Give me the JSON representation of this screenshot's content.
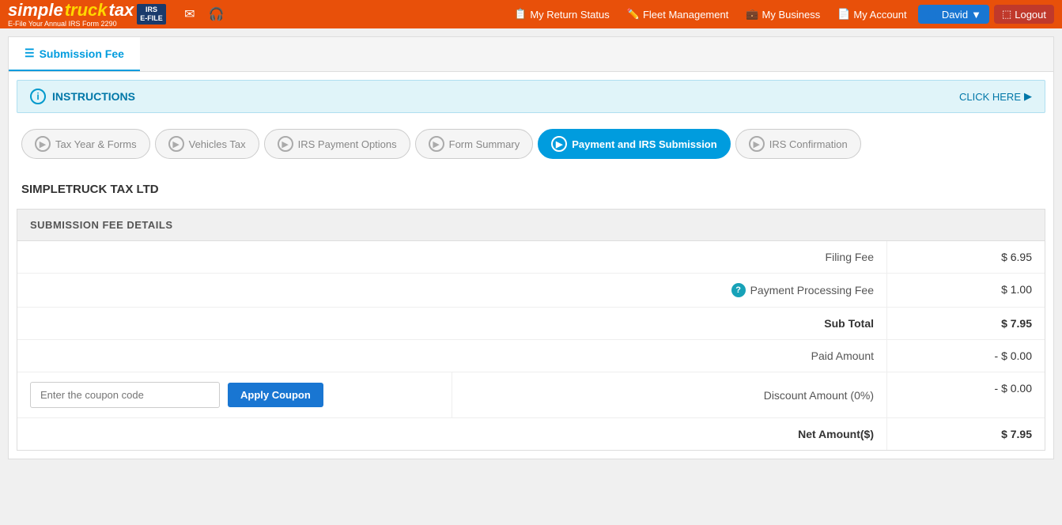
{
  "nav": {
    "logo": {
      "simple": "simple",
      "truck": "truck",
      "tax": " tax",
      "tagline": "E-File Your Annual IRS Form 2290"
    },
    "irs_badge": "IRS\nE-FILE",
    "links": [
      {
        "label": "My Return Status",
        "icon": "📋"
      },
      {
        "label": "Fleet Management",
        "icon": "✏️"
      },
      {
        "label": "My Business",
        "icon": "💼"
      },
      {
        "label": "My Account",
        "icon": "📄"
      }
    ],
    "user_btn": "David",
    "logout_btn": "Logout"
  },
  "tabs": [
    {
      "label": "Submission Fee",
      "active": true
    }
  ],
  "instructions": {
    "label": "INSTRUCTIONS",
    "click_here": "CLICK HERE"
  },
  "steps": [
    {
      "label": "Tax Year & Forms",
      "active": false
    },
    {
      "label": "Vehicles Tax",
      "active": false
    },
    {
      "label": "IRS Payment Options",
      "active": false
    },
    {
      "label": "Form Summary",
      "active": false
    },
    {
      "label": "Payment and IRS Submission",
      "active": true
    },
    {
      "label": "IRS Confirmation",
      "active": false
    }
  ],
  "company_name": "SIMPLETRUCK TAX LTD",
  "fee_section": {
    "header": "SUBMISSION FEE DETAILS",
    "rows": [
      {
        "label": "Filing Fee",
        "value": "$ 6.95",
        "has_help": false,
        "bold": false
      },
      {
        "label": "Payment Processing Fee",
        "value": "$ 1.00",
        "has_help": true,
        "bold": false
      },
      {
        "label": "Sub Total",
        "value": "$ 7.95",
        "has_help": false,
        "bold": true
      },
      {
        "label": "Paid Amount",
        "value": "- $ 0.00",
        "has_help": false,
        "bold": false
      }
    ],
    "coupon_placeholder": "Enter the coupon code",
    "apply_btn": "Apply Coupon",
    "discount_label": "Discount Amount (0%)",
    "discount_value": "- $ 0.00",
    "net_label": "Net Amount($)",
    "net_value": "$ 7.95"
  }
}
